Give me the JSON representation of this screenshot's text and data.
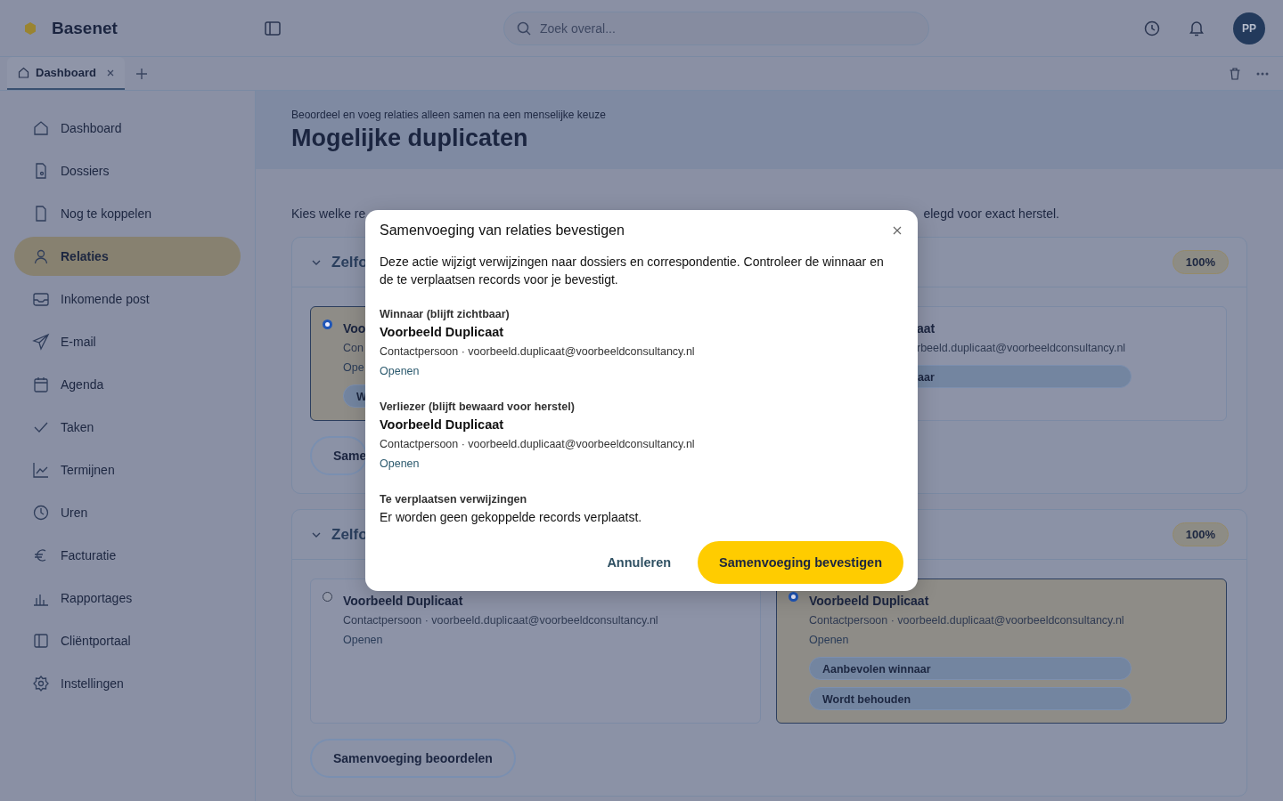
{
  "app": {
    "name": "Basenet"
  },
  "search": {
    "placeholder": "Zoek overal..."
  },
  "user": {
    "initials": "PP"
  },
  "tabs": [
    {
      "label": "Dashboard",
      "selected": true
    }
  ],
  "sidebar": {
    "items": [
      {
        "label": "Dashboard",
        "selected": false
      },
      {
        "label": "Dossiers",
        "selected": false
      },
      {
        "label": "Nog te koppelen",
        "selected": false
      },
      {
        "label": "Relaties",
        "selected": true
      },
      {
        "label": "Inkomende post",
        "selected": false
      },
      {
        "label": "E-mail",
        "selected": false
      },
      {
        "label": "Agenda",
        "selected": false
      },
      {
        "label": "Taken",
        "selected": false
      },
      {
        "label": "Termijnen",
        "selected": false
      },
      {
        "label": "Uren",
        "selected": false
      },
      {
        "label": "Facturatie",
        "selected": false
      },
      {
        "label": "Rapportages",
        "selected": false
      },
      {
        "label": "Cliëntportaal",
        "selected": false
      },
      {
        "label": "Instellingen",
        "selected": false
      }
    ]
  },
  "page": {
    "subtitle": "Beoordeel en voeg relaties alleen samen na een menselijke keuze",
    "title": "Mogelijke duplicaten",
    "intro_start": "Kies welke re",
    "intro_end": "elegd voor exact herstel."
  },
  "groups": [
    {
      "title": "Zelfo",
      "badge": "100%",
      "expanded": true,
      "button": "Same",
      "candidates": [
        {
          "name": "Voo",
          "meta": "Con",
          "link": "Ope",
          "chips": [
            "W"
          ],
          "selected": true
        },
        {
          "name": "aat",
          "meta": "rbeeld.duplicaat@voorbeeldconsultancy.nl",
          "chips": [
            "aar"
          ],
          "selected": false
        }
      ]
    },
    {
      "title": "Zelfo",
      "badge": "100%",
      "expanded": true,
      "button": "Samenvoeging beoordelen",
      "candidates": [
        {
          "name": "Voorbeeld Duplicaat",
          "meta": "Contactpersoon · voorbeeld.duplicaat@voorbeeldconsultancy.nl",
          "link": "Openen",
          "selected": false
        },
        {
          "name": "Voorbeeld Duplicaat",
          "meta": "Contactpersoon · voorbeeld.duplicaat@voorbeeldconsultancy.nl",
          "link": "Openen",
          "chips": [
            "Aanbevolen winnaar",
            "Wordt behouden"
          ],
          "selected": true
        }
      ]
    }
  ],
  "modal": {
    "title": "Samenvoeging van relaties bevestigen",
    "intro": "Deze actie wijzigt verwijzingen naar dossiers en correspondentie. Controleer de winnaar en de te verplaatsen records voor je bevestigt.",
    "sections": [
      {
        "kind": "record",
        "label": "Winnaar (blijft zichtbaar)",
        "name": "Voorbeeld Duplicaat",
        "meta": "Contactpersoon · voorbeeld.duplicaat@voorbeeldconsultancy.nl",
        "link": "Openen"
      },
      {
        "kind": "record",
        "label": "Verliezer (blijft bewaard voor herstel)",
        "name": "Voorbeeld Duplicaat",
        "meta": "Contactpersoon · voorbeeld.duplicaat@voorbeeldconsultancy.nl",
        "link": "Openen"
      },
      {
        "kind": "note",
        "label": "Te verplaatsen verwijzingen",
        "text": "Er worden geen gekoppelde records verplaatst."
      }
    ],
    "cancel": "Annuleren",
    "confirm": "Samenvoeging bevestigen"
  }
}
